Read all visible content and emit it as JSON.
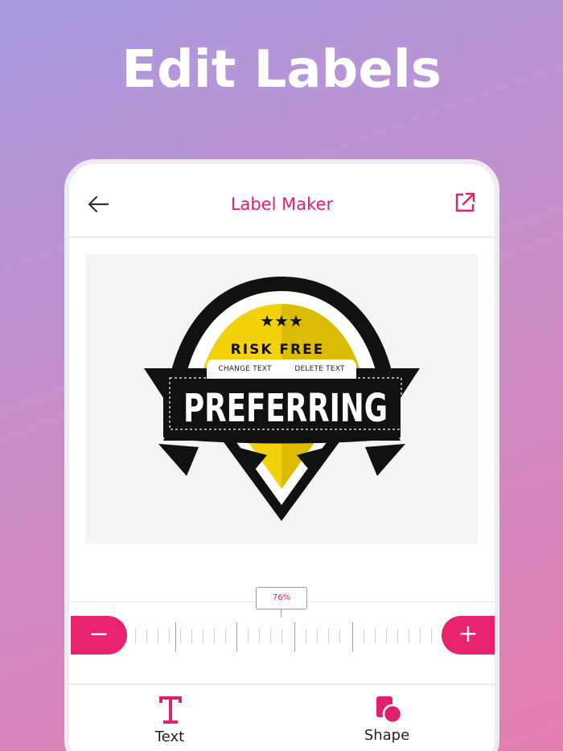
{
  "headline": "Edit Labels",
  "appbar": {
    "title": "Label Maker",
    "back_icon": "arrow-left-icon",
    "share_icon": "external-share-icon"
  },
  "canvas": {
    "label_top_text": "RISK FREE",
    "label_main_text": "PREFERRING",
    "stars": "★★★",
    "change_text_label": "CHANGE TEXT",
    "delete_text_label": "DELETE TEXT"
  },
  "zoom": {
    "value": "76%",
    "minus_label": "−",
    "plus_label": "+"
  },
  "tabs": [
    {
      "label": "Text",
      "icon": "text-t-icon"
    },
    {
      "label": "Shape",
      "icon": "shape-icon"
    }
  ],
  "colors": {
    "accent": "#e9226f",
    "title": "#e0206e",
    "badge_yellow": "#f3d20b",
    "badge_black": "#111111"
  }
}
